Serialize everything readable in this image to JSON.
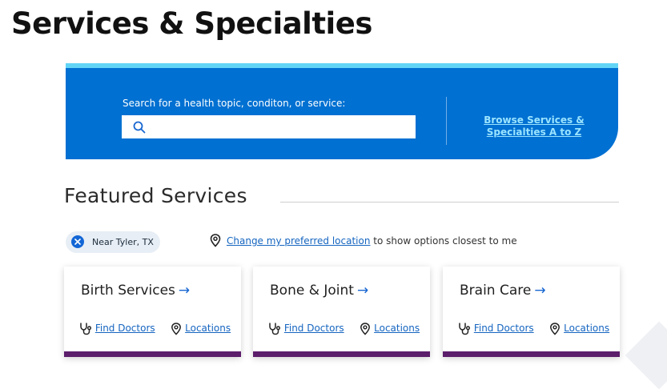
{
  "page": {
    "title": "Services & Specialties"
  },
  "search": {
    "label": "Search for a health topic, conditon, or service:",
    "value": "",
    "browse_link": "Browse Services & Specialties A to Z"
  },
  "featured": {
    "title": "Featured Services",
    "location_chip": "Near Tyler, TX",
    "change_location_link": "Change my preferred location",
    "change_location_suffix": " to show options closest to me",
    "cards": [
      {
        "title": "Birth Services",
        "find_doctors": "Find Doctors",
        "locations": "Locations"
      },
      {
        "title": "Bone & Joint",
        "find_doctors": "Find Doctors",
        "locations": "Locations"
      },
      {
        "title": "Brain Care",
        "find_doctors": "Find Doctors",
        "locations": "Locations"
      }
    ]
  },
  "icons": {
    "search": "search-icon",
    "close": "close-circle-icon",
    "location": "map-pin-icon",
    "stethoscope": "stethoscope-icon",
    "arrow": "arrow-right-icon"
  },
  "colors": {
    "band": "#0070d2",
    "band_top_stripe": "#62d4f5",
    "card_accent": "#5c1d6b",
    "link": "#1565c0"
  }
}
